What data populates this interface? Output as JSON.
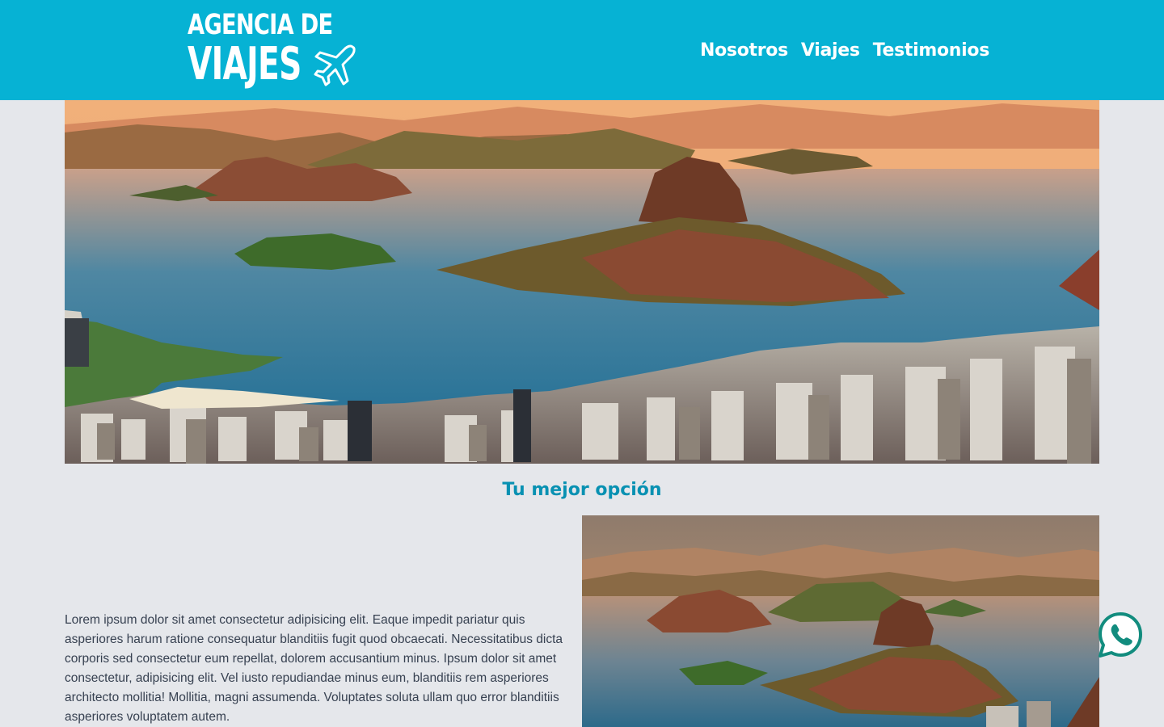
{
  "header": {
    "logo_line1": "AGENCIA DE",
    "logo_line2": "VIAJES",
    "logo_icon": "airplane-icon",
    "nav": [
      {
        "label": "Nosotros"
      },
      {
        "label": "Viajes"
      },
      {
        "label": "Testimonios"
      }
    ]
  },
  "hero": {
    "image": "rio-de-janeiro-sugarloaf-landscape"
  },
  "section": {
    "title": "Tu mejor opción",
    "text": "Lorem ipsum dolor sit amet consectetur adipisicing elit. Eaque impedit pariatur quis asperiores harum ratione consequatur blanditiis fugit quod obcaecati. Necessitatibus dicta corporis sed consectetur eum repellat, dolorem accusantium minus. Ipsum dolor sit amet consectetur, adipisicing elit. Vel iusto repudiandae minus eum, blanditiis rem asperiores architecto mollitia! Mollitia, magni assumenda. Voluptates soluta ullam quo error blanditiis asperiores voluptatem autem.",
    "image": "rio-de-janeiro-sunset-landscape"
  },
  "floating": {
    "whatsapp_icon": "whatsapp-icon"
  },
  "colors": {
    "header_bg": "#06b2d4",
    "page_bg": "#e5e7eb",
    "accent": "#0891b2",
    "whatsapp": "#128c7e"
  }
}
